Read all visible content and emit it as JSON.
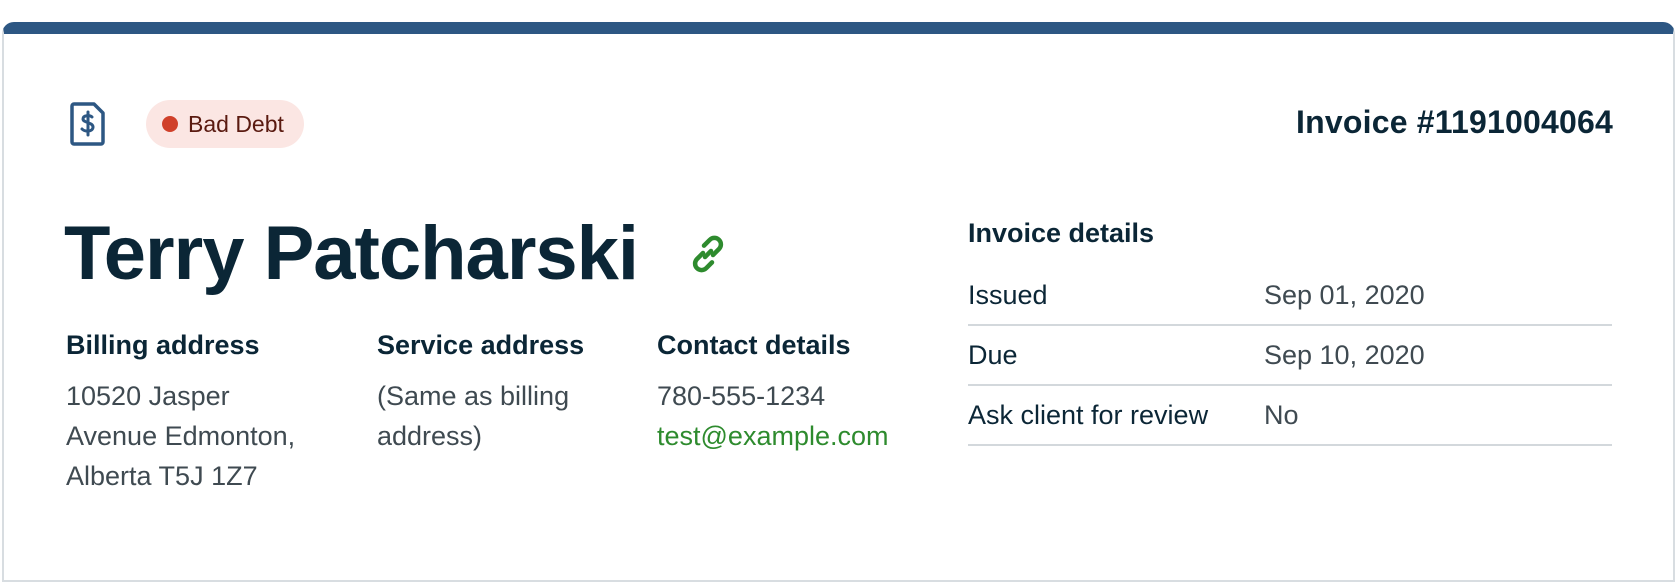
{
  "header": {
    "doc_icon": "invoice-dollar-icon",
    "status_badge": "Bad Debt",
    "status_color": "#d0402a",
    "invoice_number": "Invoice #1191004064"
  },
  "client": {
    "name": "Terry Patcharski",
    "link_icon": "link-icon"
  },
  "billing": {
    "title": "Billing address",
    "lines": [
      "10520 Jasper",
      "Avenue Edmonton,",
      "Alberta T5J 1Z7"
    ]
  },
  "service": {
    "title": "Service address",
    "lines": [
      "(Same as billing",
      "address)"
    ]
  },
  "contact": {
    "title": "Contact details",
    "phone": "780-555-1234",
    "email": "test@example.com"
  },
  "invoice_details": {
    "title": "Invoice details",
    "rows": [
      {
        "label": "Issued",
        "value": "Sep 01, 2020"
      },
      {
        "label": "Due",
        "value": "Sep 10, 2020"
      },
      {
        "label": "Ask client for review",
        "value": "No"
      }
    ]
  },
  "colors": {
    "accent_bar": "#2d5783",
    "primary_text": "#0b2636",
    "link_green": "#2e8b2e"
  }
}
